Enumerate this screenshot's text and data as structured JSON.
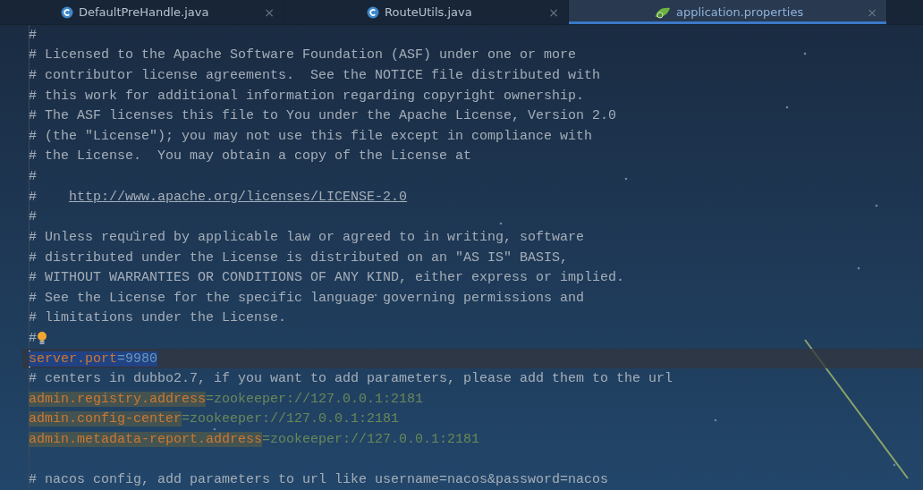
{
  "tabs": [
    {
      "label": "DefaultPreHandle.java",
      "kind": "class",
      "selected": false,
      "close": "×"
    },
    {
      "label": "RouteUtils.java",
      "kind": "class",
      "selected": false,
      "close": "×"
    },
    {
      "label": "application.properties",
      "kind": "properties",
      "selected": true,
      "close": "×"
    }
  ],
  "lines": [
    {
      "kind": "comment",
      "text": "#"
    },
    {
      "kind": "comment",
      "text": "# Licensed to the Apache Software Foundation (ASF) under one or more"
    },
    {
      "kind": "comment",
      "text": "# contributor license agreements.  See the NOTICE file distributed with"
    },
    {
      "kind": "comment",
      "text": "# this work for additional information regarding copyright ownership."
    },
    {
      "kind": "comment",
      "text": "# The ASF licenses this file to You under the Apache License, Version 2.0"
    },
    {
      "kind": "comment",
      "text": "# (the \"License\"); you may not use this file except in compliance with"
    },
    {
      "kind": "comment",
      "text": "# the License.  You may obtain a copy of the License at"
    },
    {
      "kind": "comment",
      "text": "#"
    },
    {
      "kind": "link",
      "text": "#    ",
      "url": "http://www.apache.org/licenses/LICENSE-2.0"
    },
    {
      "kind": "comment",
      "text": "#"
    },
    {
      "kind": "comment",
      "text": "# Unless required by applicable law or agreed to in writing, software"
    },
    {
      "kind": "comment",
      "text": "# distributed under the License is distributed on an \"AS IS\" BASIS,"
    },
    {
      "kind": "comment",
      "text": "# WITHOUT WARRANTIES OR CONDITIONS OF ANY KIND, either express or implied."
    },
    {
      "kind": "comment",
      "text": "# See the License for the specific language governing permissions and"
    },
    {
      "kind": "comment",
      "text": "# limitations under the License."
    },
    {
      "kind": "comment",
      "text": "#",
      "bulb": true
    },
    {
      "kind": "property",
      "key": "server.port",
      "sep": "=",
      "value": "9980",
      "selected": true,
      "highlighted": false
    },
    {
      "kind": "comment",
      "text": "# centers in dubbo2.7, if you want to add parameters, please add them to the url"
    },
    {
      "kind": "property",
      "key": "admin.registry.address",
      "sep": "=",
      "value": "zookeeper://127.0.0.1:2181",
      "selected": false,
      "highlighted": true
    },
    {
      "kind": "property",
      "key": "admin.config-center",
      "sep": "=",
      "value": "zookeeper://127.0.0.1:2181",
      "selected": false,
      "highlighted": true
    },
    {
      "kind": "property",
      "key": "admin.metadata-report.address",
      "sep": "=",
      "value": "zookeeper://127.0.0.1:2181",
      "selected": false,
      "highlighted": true
    },
    {
      "kind": "blank"
    },
    {
      "kind": "comment",
      "text": "# nacos config, add parameters to url like username=nacos&password=nacos"
    }
  ]
}
